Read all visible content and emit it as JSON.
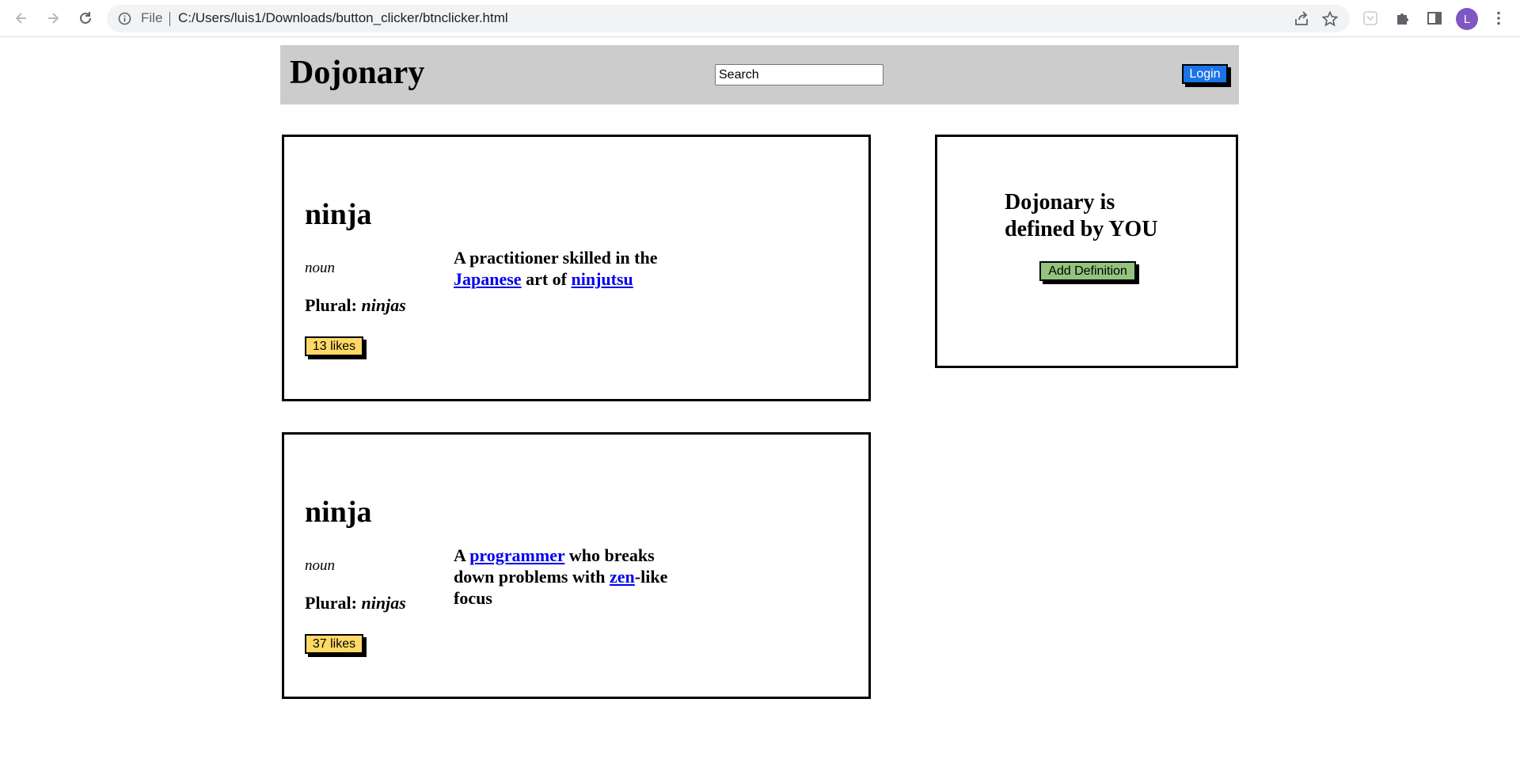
{
  "browser": {
    "scheme_label": "File",
    "url": "C:/Users/luis1/Downloads/button_clicker/btnclicker.html",
    "profile_initial": "L"
  },
  "header": {
    "title": "Dojonary",
    "search_placeholder": "Search",
    "login_label": "Login"
  },
  "entries": [
    {
      "word": "ninja",
      "part_of_speech": "noun",
      "plural_label": "Plural: ",
      "plural_value": "ninjas",
      "definition_parts": [
        "A practitioner skilled in the ",
        "Japanese",
        " art of ",
        "ninjutsu"
      ],
      "likes_label": "13 likes"
    },
    {
      "word": "ninja",
      "part_of_speech": "noun",
      "plural_label": "Plural: ",
      "plural_value": "ninjas",
      "definition_parts": [
        "A ",
        "programmer",
        " who breaks down problems with ",
        "zen",
        "-like focus"
      ],
      "likes_label": "37 likes"
    }
  ],
  "promo": {
    "text": "Dojonary is defined by YOU",
    "button_label": "Add Definition"
  },
  "colors": {
    "header_bg": "#cccccc",
    "login_button": "#1a73e8",
    "likes_button": "#ffd966",
    "add_button": "#93c47d",
    "link": "#0000ee"
  },
  "icons": [
    "back-icon",
    "forward-icon",
    "reload-icon",
    "info-icon",
    "share-icon",
    "star-icon",
    "pocket-icon",
    "puzzle-icon",
    "side-panel-icon",
    "menu-icon"
  ]
}
